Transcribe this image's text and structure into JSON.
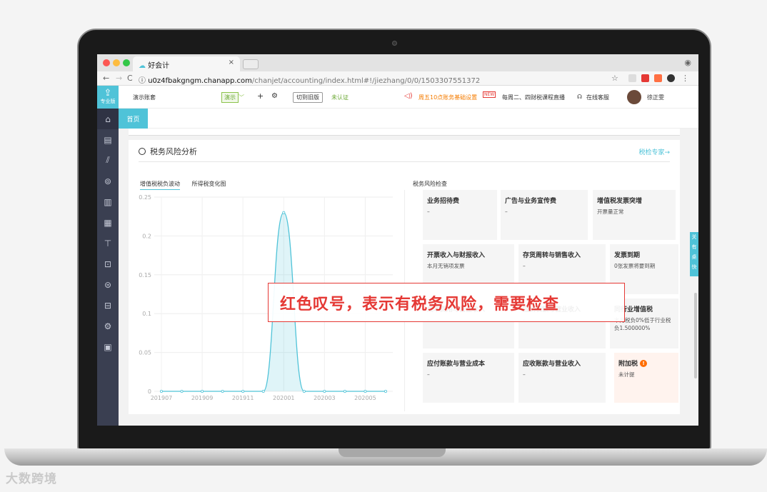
{
  "browser": {
    "tab_title": "好会计",
    "tab_close": "×",
    "profile_icon": "person-icon",
    "url_host": "u0z4fbakgngm.chanapp.com",
    "url_path": "/chanjet/accounting/index.html#!/jiezhang/0/0/1503307551372",
    "back": "←",
    "forward": "→",
    "reload": "C",
    "star": "☆"
  },
  "sidebar": {
    "logo_label": "专业版",
    "items": [
      "home-icon",
      "voucher-icon",
      "chart-icon",
      "money-bag-icon",
      "ledger-icon",
      "report-icon",
      "invoice-icon",
      "asset-icon",
      "salary-icon",
      "export-icon",
      "settings-icon",
      "video-icon"
    ]
  },
  "topbar": {
    "account_name": "演示账套",
    "demo_badge": "演示",
    "add": "+",
    "switch_old": "切到旧版",
    "unverified": "未认证",
    "notice1": "周五10点账务基础设置",
    "notice2": "每周二、四财税课程直播",
    "new_badge": "NEW",
    "service": "在线客服",
    "username": "徐正雯"
  },
  "subnav": {
    "home": "首页"
  },
  "panel": {
    "title": "税务风险分析",
    "expert_link": "税检专家→",
    "tab1": "增值税税负波动",
    "tab2": "所得税变化图",
    "check_title": "税务风险检查"
  },
  "chart_data": {
    "type": "area",
    "categories": [
      "201907",
      "201909",
      "201911",
      "202001",
      "202003",
      "202005"
    ],
    "y_ticks": [
      "0.25",
      "0.2",
      "0.15",
      "0.1",
      "0.05",
      "0"
    ],
    "ylim": [
      0,
      0.25
    ],
    "series": [
      {
        "values": [
          0,
          0,
          0,
          0,
          0,
          0,
          0.23,
          0,
          0,
          0,
          0,
          0
        ]
      }
    ],
    "x_point_labels": [
      "201907",
      "201908",
      "201909",
      "201910",
      "201911",
      "201912",
      "202001",
      "202002",
      "202003",
      "202004",
      "202005",
      "202006"
    ],
    "grid": true,
    "color": "#4fc3d8"
  },
  "tiles": [
    {
      "title": "业务招待费",
      "sub": "–"
    },
    {
      "title": "广告与业务宣传费",
      "sub": "–"
    },
    {
      "title": "增值税发票突增",
      "sub": "开票量正常"
    },
    {
      "title": "开票收入与财报收入",
      "sub": "本月无销项发票"
    },
    {
      "title": "存货周转与销售收入",
      "sub": "–"
    },
    {
      "title": "发票到期",
      "sub": "0张发票将要到期"
    },
    {
      "title": "成本费用与营业收入",
      "sub": "–"
    },
    {
      "title": "应纳税额与营业收入",
      "sub": "–"
    },
    {
      "title": "同行业增值税",
      "sub": "本月税负0%低于行业税负1.500000%"
    },
    {
      "title": "应付账款与营业成本",
      "sub": "–"
    },
    {
      "title": "应收账款与营业收入",
      "sub": "–"
    },
    {
      "title": "附加税",
      "sub": "未计提",
      "warn": "!"
    }
  ],
  "side_float": "关有桌快",
  "callout": "红色叹号，表示有税务风险，需要检查",
  "watermark": "大数跨境"
}
